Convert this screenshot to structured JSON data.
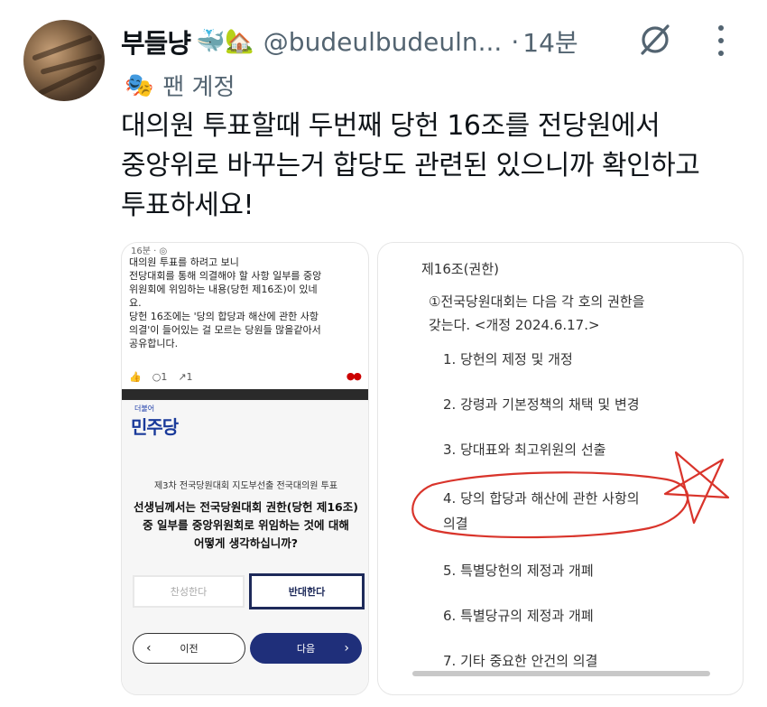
{
  "author": {
    "name": "부들냥",
    "emoji": "🐳🏡",
    "handle": "@budeulbudeuln...",
    "time": "14분",
    "badge": "팬 계정"
  },
  "icons": {
    "badge_icon": "theater-mask-icon",
    "grok_icon": "grok-icon",
    "more_icon": "more-vertical-icon"
  },
  "tweet": {
    "lines": [
      "대의원 투표할때 두번째 당헌 16조를 전당원에서",
      "중앙위로 바꾸는거 합당도 관련된 있으니까 확인하고",
      "투표하세요!"
    ]
  },
  "left_image": {
    "header": "16분 · ◎",
    "post_lines": [
      "대의원 투표를 하려고 보니",
      "전당대회를 통해 의결해야 할 사항 일부를 중앙",
      "위원회에 위임하는 내용(당헌 제16조)이 있네",
      "요.",
      "당헌 16조에는 '당의 합당과 해산에 관한 사항",
      "의결'이 들어있는 걸 모르는 당원들 많을같아서",
      "공유합니다."
    ],
    "reactions": {
      "comments": "1",
      "shares": "1"
    },
    "party_small": "더불어",
    "party_logo": "민주당",
    "vote_subtitle": "제3차 전국당원대회 지도부선출 전국대의원 투표",
    "vote_question": [
      "선생님께서는 전국당원대회 권한(당헌 제16조)",
      "중 일부를 중앙위원회로 위임하는 것에 대해",
      "어떻게 생각하십니까?"
    ],
    "agree_label": "찬성한다",
    "oppose_label": "반대한다",
    "prev_label": "이전",
    "next_label": "다음"
  },
  "right_image": {
    "title": "제16조(권한)",
    "paragraph": [
      "①전국당원대회는 다음 각 호의 권한을",
      "갖는다. <개정 2024.6.17.>"
    ],
    "items": [
      "1. 당헌의 제정 및 개정",
      "2. 강령과 기본정책의 채택 및 변경",
      "3. 당대표와 최고위원의 선출",
      "4. 당의 합당과 해산에 관한 사항의",
      "의결",
      "5. 특별당헌의 제정과 개폐",
      "6. 특별당규의 제정과 개폐",
      "7. 기타 중요한 안건의 의결"
    ],
    "annotation_color": "#d9342b"
  }
}
